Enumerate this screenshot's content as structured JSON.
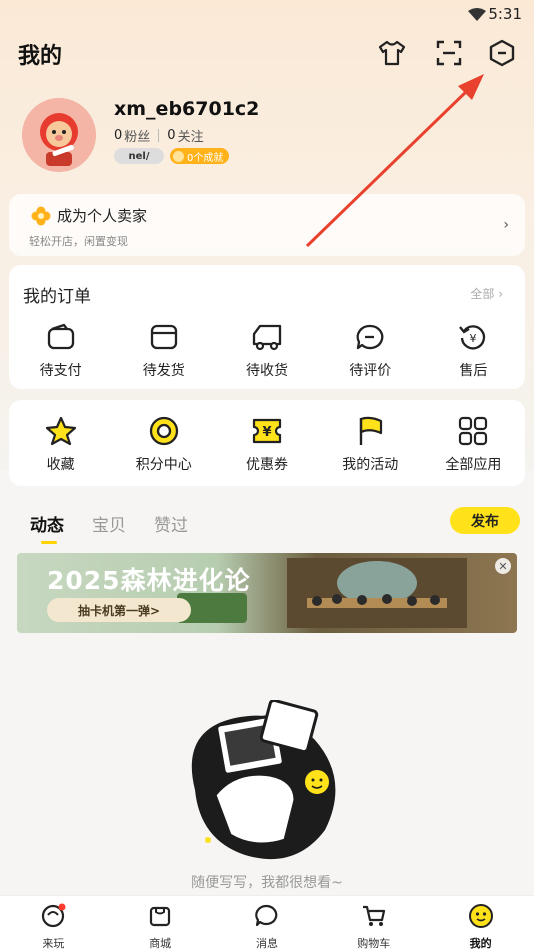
{
  "status": {
    "time": "5:31"
  },
  "header": {
    "title": "我的"
  },
  "profile": {
    "username": "xm_eb6701c2",
    "fans_count": "0",
    "fans_label": "粉丝",
    "follow_count": "0",
    "follow_label": "关注",
    "badge_level": "nel/",
    "badge_achievement": "0个成就"
  },
  "seller": {
    "title": "成为个人卖家",
    "subtitle": "轻松开店，闲置变现"
  },
  "orders": {
    "title": "我的订单",
    "see_all": "全部 ›",
    "items": [
      {
        "label": "待支付",
        "icon": "wallet-icon"
      },
      {
        "label": "待发货",
        "icon": "box-icon"
      },
      {
        "label": "待收货",
        "icon": "truck-icon"
      },
      {
        "label": "待评价",
        "icon": "comment-icon"
      },
      {
        "label": "售后",
        "icon": "refund-icon"
      }
    ]
  },
  "tools": {
    "items": [
      {
        "label": "收藏",
        "icon": "star-icon"
      },
      {
        "label": "积分中心",
        "icon": "points-icon"
      },
      {
        "label": "优惠券",
        "icon": "coupon-icon"
      },
      {
        "label": "我的活动",
        "icon": "flag-icon"
      },
      {
        "label": "全部应用",
        "icon": "apps-grid-icon"
      }
    ]
  },
  "feed_tabs": {
    "tabs": [
      "动态",
      "宝贝",
      "赞过"
    ],
    "active": "动态",
    "publish": "发布"
  },
  "banner": {
    "title": "2025森林进化论",
    "button": "抽卡机第一弹>"
  },
  "empty": {
    "text": "随便写写，我都很想看~"
  },
  "bottom_nav": {
    "items": [
      {
        "label": "来玩",
        "icon": "play-icon"
      },
      {
        "label": "商城",
        "icon": "store-icon"
      },
      {
        "label": "消息",
        "icon": "message-icon"
      },
      {
        "label": "购物车",
        "icon": "cart-icon"
      },
      {
        "label": "我的",
        "icon": "me-icon"
      }
    ],
    "active": "我的"
  },
  "colors": {
    "accent": "#ffe21a",
    "badge": "#ffb21a",
    "arrow": "#e8412d"
  }
}
